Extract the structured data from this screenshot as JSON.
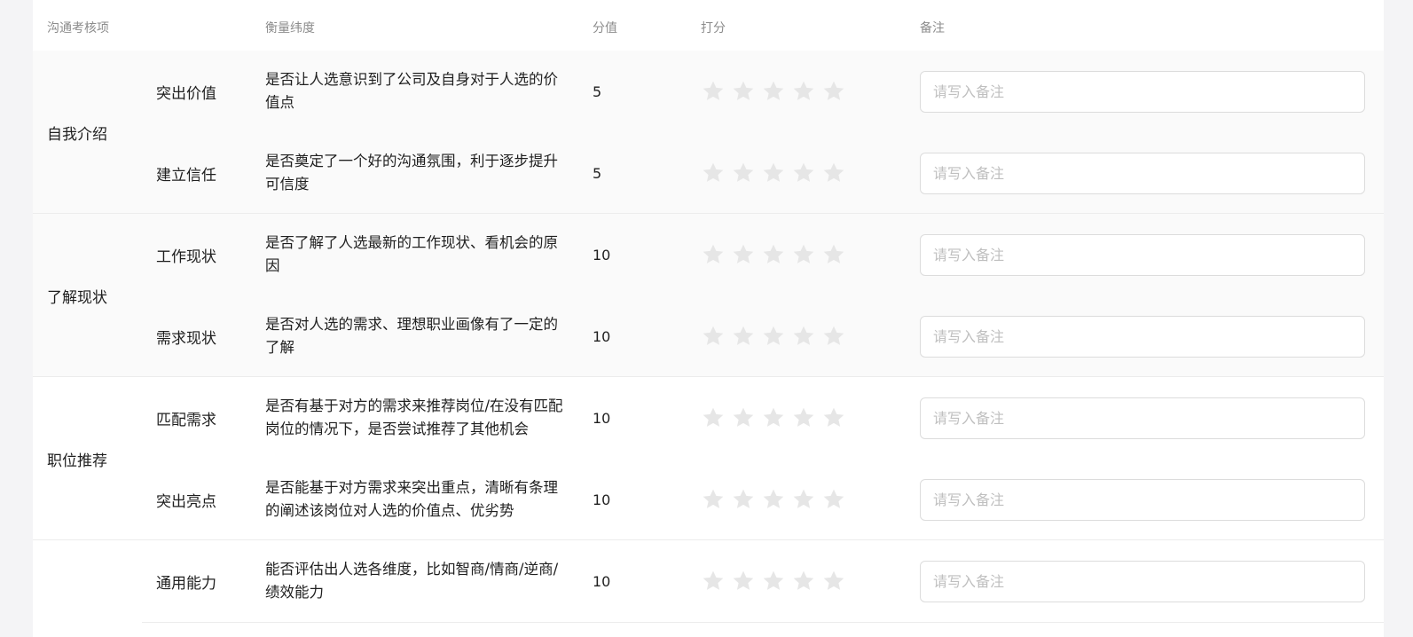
{
  "columns": {
    "category": "沟通考核项",
    "dimension": "衡量纬度",
    "score": "分值",
    "rating": "打分",
    "note": "备注"
  },
  "note_placeholder": "请写入备注",
  "star_color": "#e6e6e6",
  "groups": [
    {
      "label": "自我介绍",
      "rows": [
        {
          "item": "突出价值",
          "dimension": "是否让人选意识到了公司及自身对于人选的价值点",
          "score": "5",
          "rating": 0
        },
        {
          "item": "建立信任",
          "dimension": "是否奠定了一个好的沟通氛围，利于逐步提升可信度",
          "score": "5",
          "rating": 0
        }
      ]
    },
    {
      "label": "了解现状",
      "rows": [
        {
          "item": "工作现状",
          "dimension": "是否了解了人选最新的工作现状、看机会的原因",
          "score": "10",
          "rating": 0
        },
        {
          "item": "需求现状",
          "dimension": "是否对人选的需求、理想职业画像有了一定的了解",
          "score": "10",
          "rating": 0
        }
      ]
    },
    {
      "label": "职位推荐",
      "rows": [
        {
          "item": "匹配需求",
          "dimension": "是否有基于对方的需求来推荐岗位/在没有匹配岗位的情况下，是否尝试推荐了其他机会",
          "score": "10",
          "rating": 0
        },
        {
          "item": "突出亮点",
          "dimension": "是否能基于对方需求来突出重点，清晰有条理的阐述该岗位对人选的价值点、优劣势",
          "score": "10",
          "rating": 0
        }
      ]
    },
    {
      "label": "",
      "rows": [
        {
          "item": "通用能力",
          "dimension": "能否评估出人选各维度，比如智商/情商/逆商/绩效能力",
          "score": "10",
          "rating": 0
        }
      ]
    }
  ]
}
